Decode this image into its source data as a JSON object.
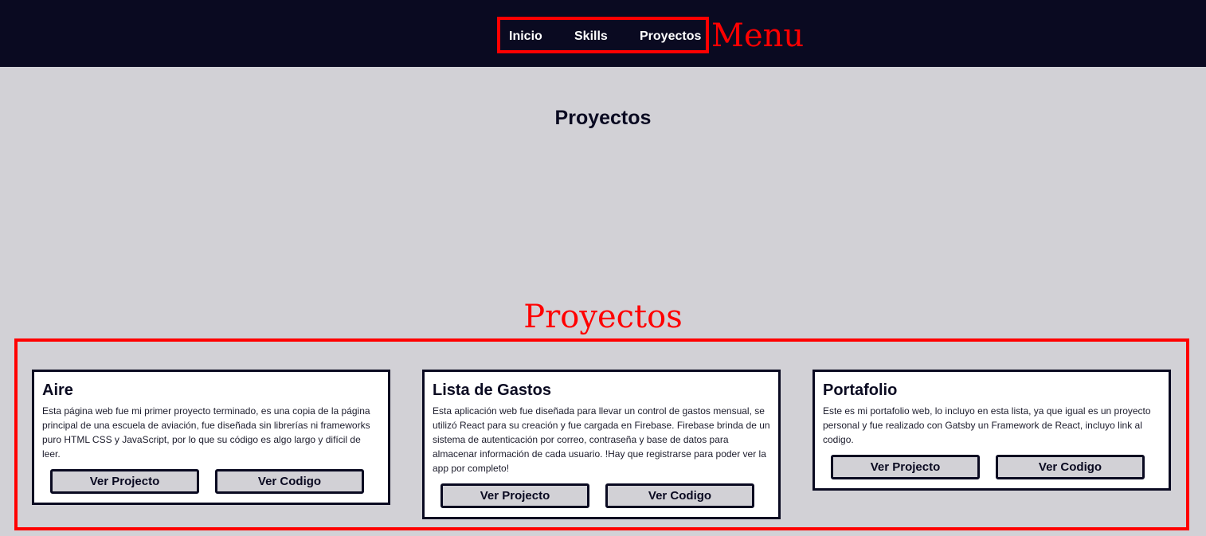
{
  "nav": {
    "items": [
      {
        "label": "Inicio"
      },
      {
        "label": "Skills"
      },
      {
        "label": "Proyectos"
      }
    ]
  },
  "annotations": {
    "menu": "Menu",
    "proyectos": "Proyectos"
  },
  "main": {
    "title": "Proyectos"
  },
  "projects": [
    {
      "title": "Aire",
      "description": "Esta página web fue mi primer proyecto terminado, es una copia de la página principal de una escuela de aviación, fue diseñada sin librerías ni frameworks puro HTML CSS y JavaScript, por lo que su código es algo largo y difícil de leer.",
      "view_label": "Ver Projecto",
      "code_label": "Ver Codigo"
    },
    {
      "title": "Lista de Gastos",
      "description": "Esta aplicación web fue diseñada para llevar un control de gastos mensual, se utilizó React para su creación y fue cargada en Firebase. Firebase brinda de un sistema de autenticación por correo, contraseña y base de datos para almacenar información de cada usuario. !Hay que registrarse para poder ver la app por completo!",
      "view_label": "Ver Projecto",
      "code_label": "Ver Codigo"
    },
    {
      "title": "Portafolio",
      "description": "Este es mi portafolio web, lo incluyo en esta lista, ya que igual es un proyecto personal y fue realizado con Gatsby un Framework de React, incluyo link al codigo.",
      "view_label": "Ver Projecto",
      "code_label": "Ver Codigo"
    }
  ],
  "colors": {
    "topbar": "#0a0a21",
    "background": "#d2d1d6",
    "annotation": "#ff0000",
    "card": "#ffffff"
  }
}
